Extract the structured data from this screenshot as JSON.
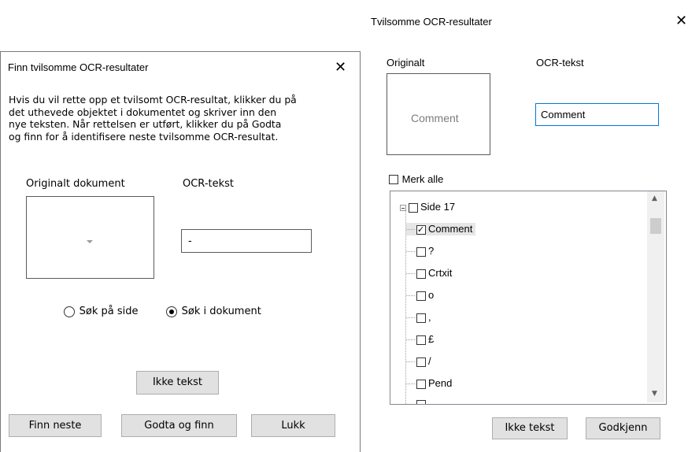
{
  "dialog1": {
    "title": "Finn tvilsomme OCR-resultater",
    "description": "Hvis du vil rette opp et tvilsomt OCR-resultat, klikker du på\ndet uthevede objektet i dokumentet og skriver inn den\nnye teksten. Når rettelsen er utført, klikker du på Godta\nog finn for å identifisere neste tvilsomme OCR-resultat.",
    "original_label": "Originalt dokument",
    "ocr_label": "OCR-tekst",
    "ocr_value": "-",
    "radio_page": "Søk på side",
    "radio_document": "Søk i dokument",
    "radio_selected": "document",
    "not_text_button": "Ikke tekst",
    "find_next_button": "Finn neste",
    "accept_find_button": "Godta og finn",
    "close_button": "Lukk"
  },
  "dialog2": {
    "title": "Tvilsomme OCR-resultater",
    "original_label": "Originalt",
    "ocr_label": "OCR-tekst",
    "original_crop_text": "Comment",
    "ocr_value": "Comment",
    "select_all": "Merk alle",
    "tree": {
      "root": "Side 17",
      "items": [
        {
          "label": "Comment",
          "checked": true,
          "selected": true
        },
        {
          "label": "?",
          "checked": false
        },
        {
          "label": "Crtxit",
          "checked": false
        },
        {
          "label": "o",
          "checked": false
        },
        {
          "label": ",",
          "checked": false
        },
        {
          "label": "£",
          "checked": false
        },
        {
          "label": "/",
          "checked": false
        },
        {
          "label": "Pend",
          "checked": false
        }
      ]
    },
    "not_text_button": "Ikke tekst",
    "approve_button": "Godkjenn"
  },
  "icons": {
    "close": "close-icon",
    "scroll_up": "chevron-up-icon",
    "scroll_down": "chevron-down-icon",
    "expander": "minus-box-icon"
  },
  "colors": {
    "focus_border": "#0078d7",
    "button_bg": "#e1e1e1"
  }
}
